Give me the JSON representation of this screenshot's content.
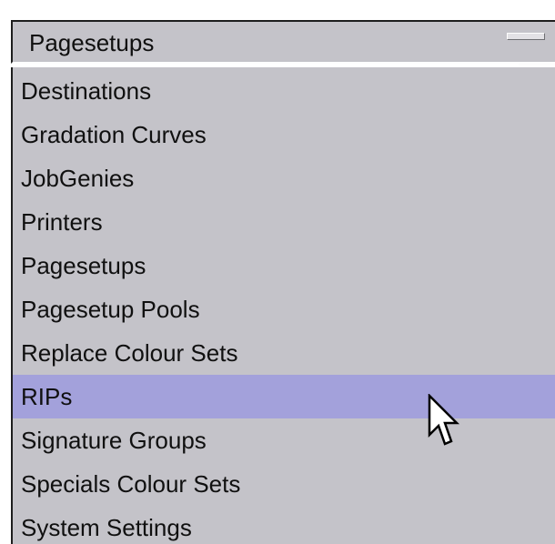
{
  "dropdown": {
    "selected_value": "Pagesetups"
  },
  "list": {
    "selected_index": 7,
    "items": [
      {
        "label": "Destinations"
      },
      {
        "label": "Gradation Curves"
      },
      {
        "label": "JobGenies"
      },
      {
        "label": "Printers"
      },
      {
        "label": "Pagesetups"
      },
      {
        "label": "Pagesetup Pools"
      },
      {
        "label": "Replace Colour Sets"
      },
      {
        "label": "RIPs"
      },
      {
        "label": "Signature Groups"
      },
      {
        "label": "Specials Colour Sets"
      },
      {
        "label": "System Settings"
      }
    ]
  },
  "colors": {
    "panel_background": "#c4c3c9",
    "selection_highlight": "#a3a1db",
    "text": "#101010"
  },
  "icons": {
    "dropdown_handle": "dropdown-handle-icon",
    "mouse_cursor": "mouse-pointer-icon"
  }
}
